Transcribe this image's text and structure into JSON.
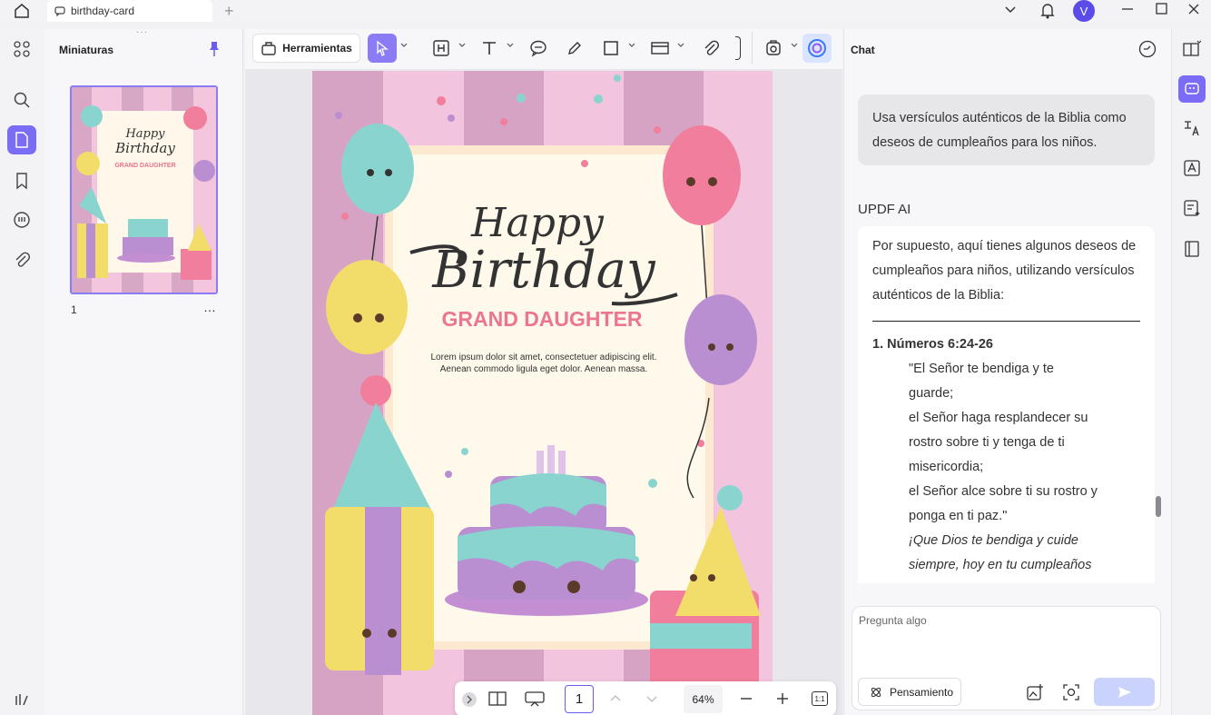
{
  "window": {
    "tab_title": "birthday-card",
    "user_initial": "V"
  },
  "thumbnails": {
    "title": "Miniaturas",
    "page_label": "1",
    "more": "…"
  },
  "toolbar": {
    "tools_label": "Herramientas"
  },
  "card": {
    "happy": "Happy",
    "birthday": "Birthday",
    "subtitle": "GRAND DAUGHTER",
    "lorem1": "Lorem ipsum dolor sit amet, consectetuer adipiscing elit.",
    "lorem2": "Aenean commodo ligula eget dolor. Aenean massa."
  },
  "bottom": {
    "page_number": "1",
    "zoom": "64%",
    "fit": "1:1"
  },
  "chat": {
    "title": "Chat",
    "user_message": "Usa versículos auténticos de la Biblia como deseos de cumpleaños para los niños.",
    "ai_label": "UPDF AI",
    "ai_intro": "Por supuesto, aquí tienes algunos deseos de cumpleaños para niños, utilizando versículos auténticos de la Biblia:",
    "item_heading": "1. Números 6:24-26",
    "verse_lines": [
      "\"El Señor te bendiga y te",
      "guarde;",
      "el Señor haga resplandecer su",
      "rostro sobre ti y tenga de ti",
      "misericordia;",
      "el Señor alce sobre ti su rostro y",
      "ponga en ti paz.\""
    ],
    "wish_lines": [
      "¡Que Dios te bendiga y cuide",
      "siempre, hoy en tu cumpleaños"
    ],
    "input_placeholder": "Pregunta algo",
    "thinking_label": "Pensamiento"
  },
  "colors": {
    "accent": "#7b6cf6",
    "send": "#c9d3fb"
  }
}
